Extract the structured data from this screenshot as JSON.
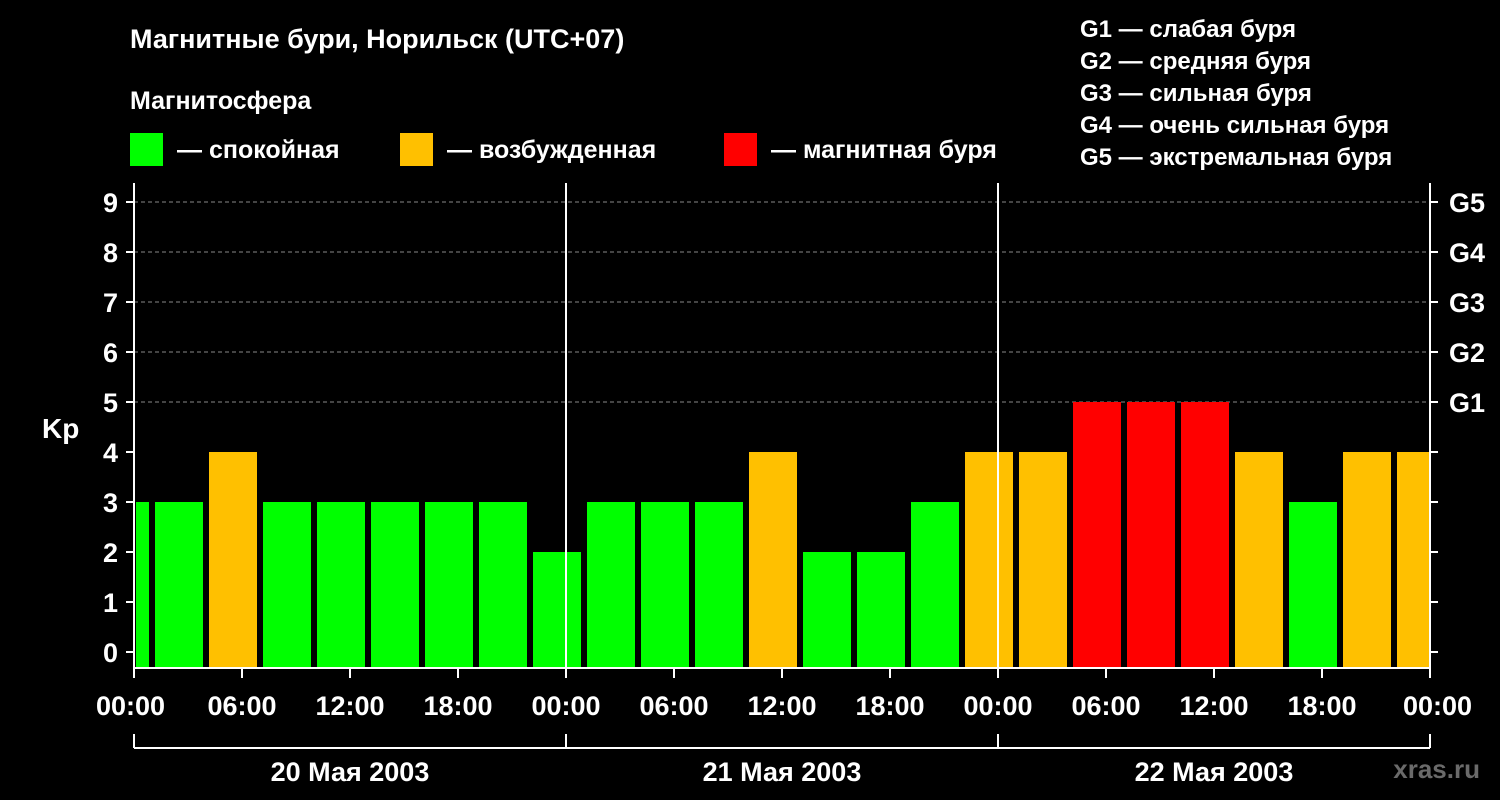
{
  "title": "Магнитные бури, Норильск (UTC+07)",
  "legend": {
    "heading": "Магнитосфера",
    "items": [
      {
        "label": "— спокойная",
        "color": "#00ff00"
      },
      {
        "label": "— возбужденная",
        "color": "#ffc000"
      },
      {
        "label": "— магнитная буря",
        "color": "#ff0000"
      }
    ]
  },
  "g_legend": [
    "G1 — слабая буря",
    "G2 — средняя буря",
    "G3 — сильная буря",
    "G4 — очень сильная буря",
    "G5 — экстремальная буря"
  ],
  "watermark": "xras.ru",
  "chart_data": {
    "type": "bar",
    "ylabel": "Kp",
    "ylim": [
      0,
      9
    ],
    "y_ticks": [
      "0",
      "1",
      "2",
      "3",
      "4",
      "5",
      "6",
      "7",
      "8",
      "9"
    ],
    "right_ticks": [
      {
        "kp": 5,
        "label": "G1"
      },
      {
        "kp": 6,
        "label": "G2"
      },
      {
        "kp": 7,
        "label": "G3"
      },
      {
        "kp": 8,
        "label": "G4"
      },
      {
        "kp": 9,
        "label": "G5"
      }
    ],
    "x_ticks": [
      "00:00",
      "06:00",
      "12:00",
      "18:00",
      "00:00",
      "06:00",
      "12:00",
      "18:00",
      "00:00",
      "06:00",
      "12:00",
      "18:00",
      "00:00"
    ],
    "days": [
      "20 Мая 2003",
      "21 Мая 2003",
      "22 Мая 2003"
    ],
    "colors": {
      "quiet": "#00ff00",
      "active": "#ffc000",
      "storm": "#ff0000"
    },
    "values": [
      3,
      3,
      4,
      3,
      3,
      3,
      3,
      3,
      2,
      3,
      3,
      3,
      4,
      2,
      2,
      3,
      4,
      4,
      5,
      5,
      5,
      4,
      3,
      4,
      4
    ],
    "grid": true
  }
}
